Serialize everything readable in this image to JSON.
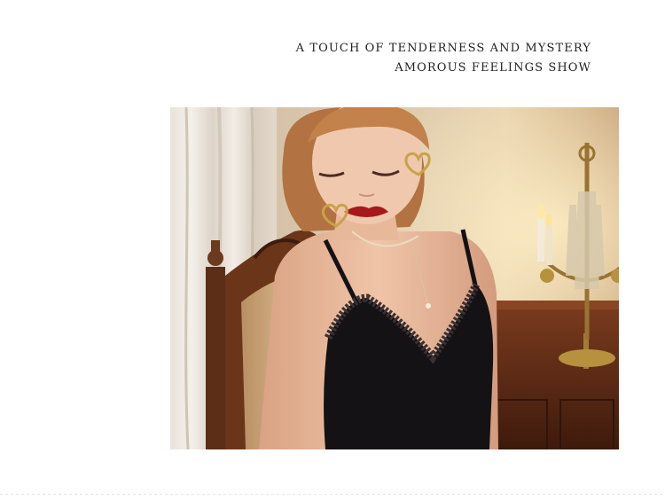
{
  "tagline": {
    "line1": "A TOUCH OF TENDERNESS AND MYSTERY",
    "line2": "AMOROUS FEELINGS SHOW"
  },
  "photo": {
    "colors": {
      "wall": "#d9c4a6",
      "curtain": "#ece6de",
      "wood": "#5a2e17",
      "skin": "#e7b699",
      "hair": "#b97845",
      "fabric": "#141214",
      "gold": "#c9a14a",
      "lips": "#a5191c"
    }
  }
}
